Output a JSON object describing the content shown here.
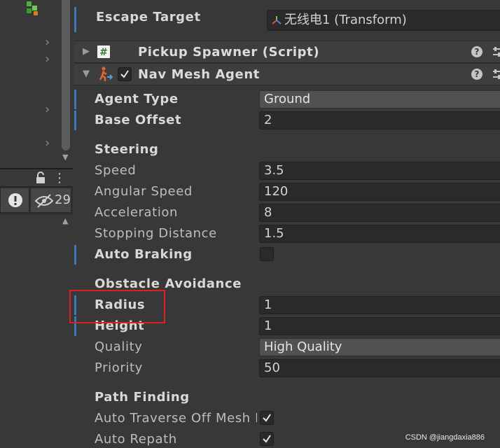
{
  "left_pane": {
    "hidden_count": "29"
  },
  "inspector": {
    "top_row": {
      "label": "Escape Target",
      "value": "无线电1 (Transform)"
    },
    "components": [
      {
        "title": "Pickup Spawner (Script)",
        "expanded": false
      },
      {
        "title": "Nav Mesh Agent",
        "expanded": true,
        "enabled": true
      }
    ],
    "agent_type": {
      "label": "Agent Type",
      "value": "Ground"
    },
    "base_offset": {
      "label": "Base Offset",
      "value": "2"
    },
    "steering": {
      "header": "Steering",
      "speed": {
        "label": "Speed",
        "value": "3.5"
      },
      "angular_speed": {
        "label": "Angular Speed",
        "value": "120"
      },
      "acceleration": {
        "label": "Acceleration",
        "value": "8"
      },
      "stopping_distance": {
        "label": "Stopping Distance",
        "value": "1.5"
      },
      "auto_braking": {
        "label": "Auto Braking",
        "checked": false
      }
    },
    "obstacle_avoidance": {
      "header": "Obstacle Avoidance",
      "radius": {
        "label": "Radius",
        "value": "1"
      },
      "height": {
        "label": "Height",
        "value": "1"
      },
      "quality": {
        "label": "Quality",
        "value": "High Quality"
      },
      "priority": {
        "label": "Priority",
        "value": "50"
      }
    },
    "path_finding": {
      "header": "Path Finding",
      "auto_traverse": {
        "label": "Auto Traverse Off Mesh Lir",
        "checked": true
      },
      "auto_repath": {
        "label": "Auto Repath",
        "checked": true
      }
    }
  },
  "watermark": "CSDN @jiangdaxia886",
  "colors": {
    "background": "#383838",
    "field": "#2a2a2a",
    "accent_blue": "#3a79bb",
    "highlight_red": "#e02020",
    "agent_icon": "#e8632b"
  }
}
